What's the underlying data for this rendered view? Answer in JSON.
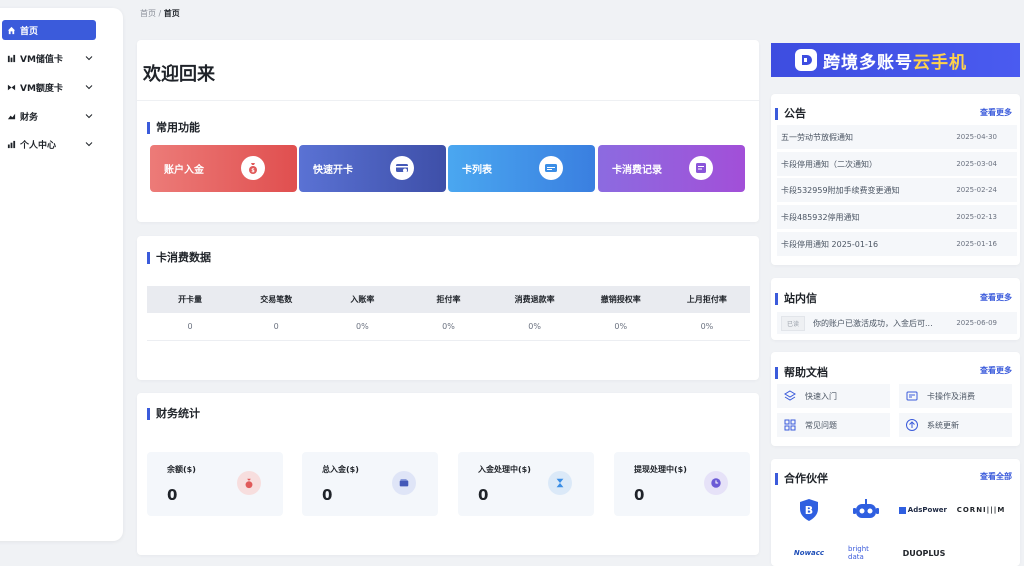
{
  "sidebar": {
    "items": [
      {
        "label": "首页",
        "icon": "home-icon"
      },
      {
        "label": "VM储值卡",
        "icon": "chart-icon"
      },
      {
        "label": "VM额度卡",
        "icon": "limit-card-icon"
      },
      {
        "label": "财务",
        "icon": "finance-icon"
      },
      {
        "label": "个人中心",
        "icon": "bar-chart-icon"
      }
    ]
  },
  "breadcrumb": {
    "root": "首页",
    "sep": "/",
    "current": "首页"
  },
  "welcome": {
    "title": "欢迎回来"
  },
  "common": {
    "title": "常用功能",
    "buttons": [
      {
        "label": "账户入金",
        "icon": "money-bag-icon",
        "color": "#e05a5a"
      },
      {
        "label": "快速开卡",
        "icon": "open-card-icon",
        "color": "#4459b8"
      },
      {
        "label": "卡列表",
        "icon": "card-list-icon",
        "color": "#3b8ee6"
      },
      {
        "label": "卡消费记录",
        "icon": "record-icon",
        "color": "#8b55d9"
      }
    ]
  },
  "consume": {
    "title": "卡消费数据",
    "headers": [
      "开卡量",
      "交易笔数",
      "入账率",
      "拒付率",
      "消费退款率",
      "撤销授权率",
      "上月拒付率"
    ],
    "row": [
      "0",
      "0",
      "0%",
      "0%",
      "0%",
      "0%",
      "0%"
    ]
  },
  "finance": {
    "title": "财务统计",
    "stats": [
      {
        "label": "余额($)",
        "value": "0",
        "icon": "money-bag-icon",
        "color": "#f7dede"
      },
      {
        "label": "总入金($)",
        "value": "0",
        "icon": "wallet-icon",
        "color": "#dfe5f7"
      },
      {
        "label": "入金处理中($)",
        "value": "0",
        "icon": "hourglass-icon",
        "color": "#dbe9f8"
      },
      {
        "label": "提现处理中($)",
        "value": "0",
        "icon": "clock-icon",
        "color": "#e6e2f8"
      }
    ]
  },
  "banner": {
    "text1": "跨境多账号",
    "text2": "云手机"
  },
  "announcement": {
    "title": "公告",
    "more": "查看更多",
    "items": [
      {
        "title": "五一劳动节放假通知",
        "date": "2025-04-30"
      },
      {
        "title": "卡段停用通知（二次通知）",
        "date": "2025-03-04"
      },
      {
        "title": "卡段532959附加手续费变更通知",
        "date": "2025-02-24"
      },
      {
        "title": "卡段485932停用通知",
        "date": "2025-02-13"
      },
      {
        "title": "卡段停用通知 2025-01-16",
        "date": "2025-01-16"
      }
    ]
  },
  "inbox": {
    "title": "站内信",
    "more": "查看更多",
    "items": [
      {
        "tag": "已读",
        "text": "你的账户已激活成功，入金后可...",
        "date": "2025-06-09"
      }
    ]
  },
  "docs": {
    "title": "帮助文档",
    "more": "查看更多",
    "items": [
      {
        "label": "快速入门",
        "icon": "layers-icon"
      },
      {
        "label": "卡操作及消费",
        "icon": "card-op-icon"
      },
      {
        "label": "常见问题",
        "icon": "grid-icon"
      },
      {
        "label": "系统更新",
        "icon": "upload-icon"
      }
    ]
  },
  "partners": {
    "title": "合作伙伴",
    "more": "查看全部",
    "items": [
      {
        "name": "",
        "icon": "shield-b-logo"
      },
      {
        "name": "",
        "icon": "robot-logo"
      },
      {
        "name": "AdsPower",
        "icon": "adspower-logo"
      },
      {
        "name": "CORNI|||M",
        "icon": "cornium-logo"
      },
      {
        "name": "Nowacc",
        "icon": "nowacc-logo"
      },
      {
        "name": "bright data",
        "icon": "brightdata-logo"
      },
      {
        "name": "DUOPLUS",
        "icon": "duoplus-logo"
      }
    ]
  }
}
